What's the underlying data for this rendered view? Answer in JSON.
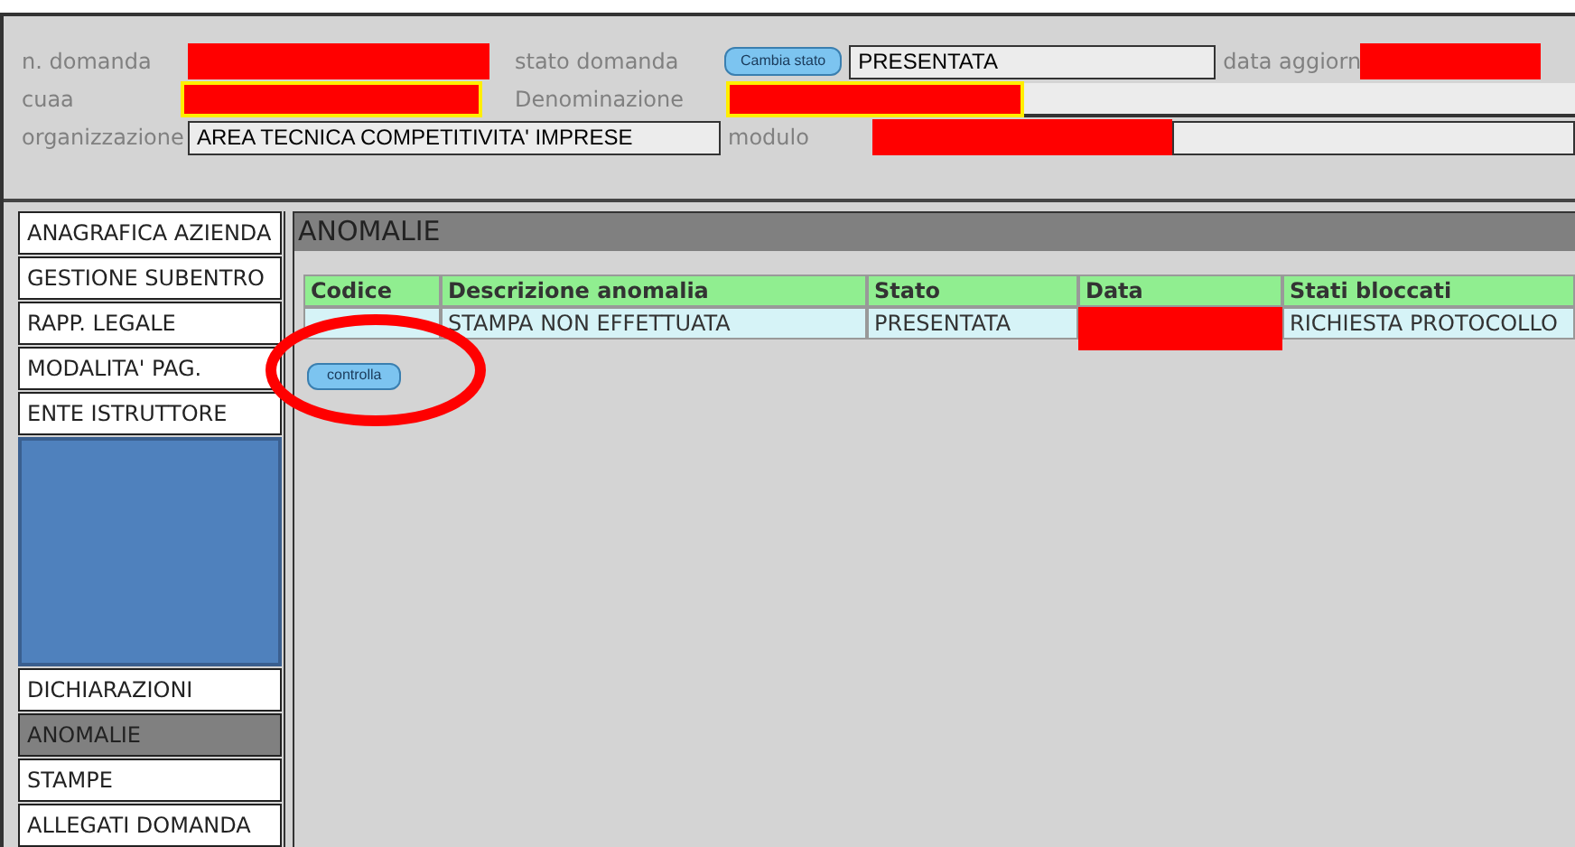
{
  "header": {
    "fields": [
      {
        "label": "n. domanda",
        "redacted": true
      },
      {
        "label": "stato domanda",
        "button": "Cambia stato",
        "value": "PRESENTATA"
      },
      {
        "label": "data aggiorn",
        "redacted": true
      },
      {
        "label": "cuaa",
        "redacted": true
      },
      {
        "label": "Denominazione",
        "redacted": true
      },
      {
        "label": "organizzazione",
        "value": "AREA TECNICA COMPETITIVITA' IMPRESE"
      },
      {
        "label": "modulo",
        "redacted": true
      }
    ]
  },
  "sidebar": {
    "items": [
      {
        "label": "ANAGRAFICA AZIENDA",
        "selected": false
      },
      {
        "label": "GESTIONE SUBENTRO",
        "selected": false
      },
      {
        "label": "RAPP. LEGALE",
        "selected": false
      },
      {
        "label": "MODALITA' PAG.",
        "selected": false
      },
      {
        "label": "ENTE ISTRUTTORE",
        "selected": false
      },
      {
        "kind": "covered"
      },
      {
        "label": "DICHIARAZIONI",
        "selected": false
      },
      {
        "label": "ANOMALIE",
        "selected": true
      },
      {
        "label": "STAMPE",
        "selected": false
      },
      {
        "label": "ALLEGATI DOMANDA",
        "selected": false
      }
    ]
  },
  "panel": {
    "title": "ANOMALIE",
    "table": {
      "columns": [
        "Codice",
        "Descrizione anomalia",
        "Stato",
        "Data",
        "Stati bloccati"
      ],
      "rows": [
        {
          "cells": [
            null,
            "STAMPA NON EFFETTUATA",
            "PRESENTATA",
            null,
            "RICHIESTA PROTOCOLLO"
          ]
        }
      ]
    },
    "button": "controlla"
  }
}
